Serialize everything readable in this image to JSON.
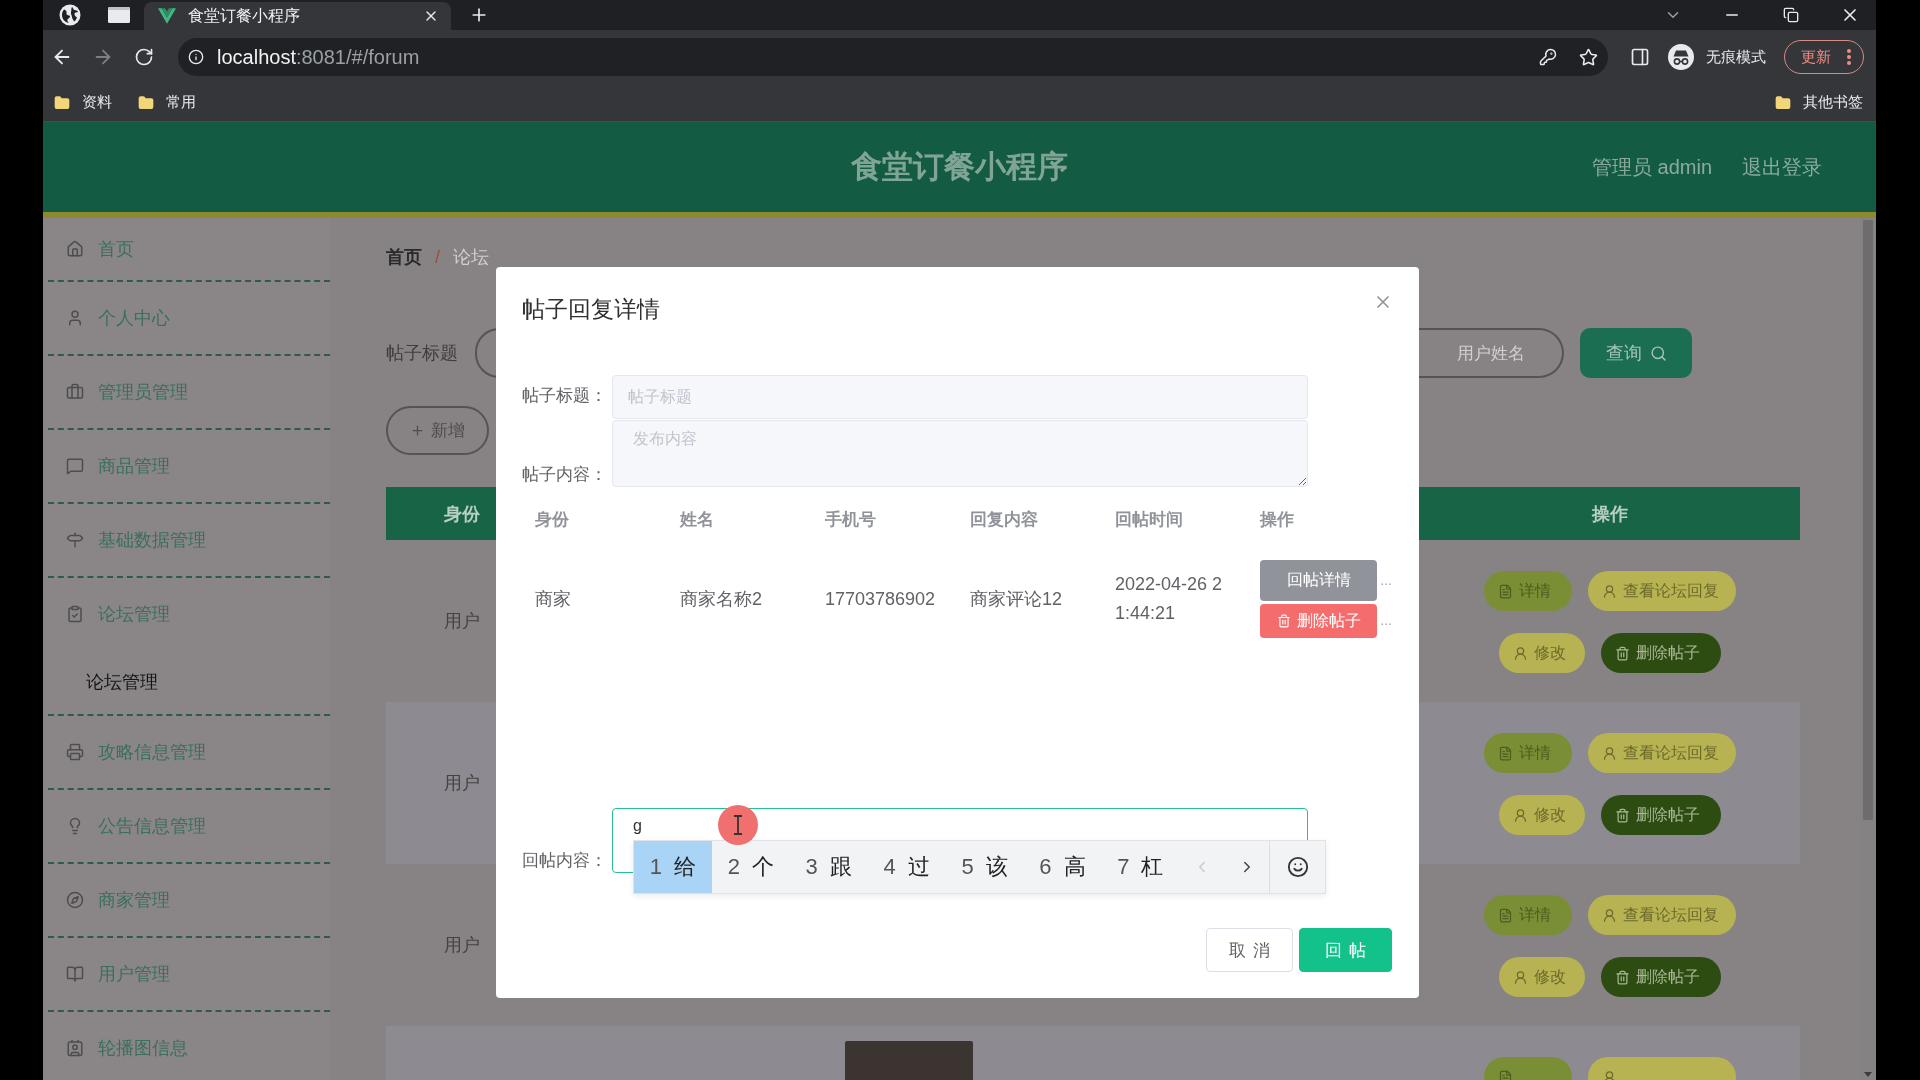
{
  "browser": {
    "tab": {
      "title": "食堂订餐小程序"
    },
    "url": {
      "host": "localhost",
      "rest": ":8081/#/forum"
    },
    "profile": "无痕模式",
    "update_button": "更新",
    "bookmarks": [
      {
        "label": "资料"
      },
      {
        "label": "常用"
      }
    ],
    "other_bookmarks": "其他书签"
  },
  "header": {
    "title": "食堂订餐小程序",
    "user": "管理员 admin",
    "logout": "退出登录"
  },
  "sidebar": {
    "items": [
      {
        "label": "首页"
      },
      {
        "label": "个人中心"
      },
      {
        "label": "管理员管理"
      },
      {
        "label": "商品管理"
      },
      {
        "label": "基础数据管理"
      },
      {
        "label": "论坛管理",
        "children": [
          {
            "label": "论坛管理"
          }
        ]
      },
      {
        "label": "攻略信息管理"
      },
      {
        "label": "公告信息管理"
      },
      {
        "label": "商家管理"
      },
      {
        "label": "用户管理"
      },
      {
        "label": "轮播图信息"
      }
    ]
  },
  "breadcrumb": {
    "separator": "/",
    "items": [
      {
        "label": "首页"
      },
      {
        "label": "论坛"
      }
    ]
  },
  "search": {
    "label": "帖子标题",
    "fields": [
      {
        "placeholder": "用户姓名"
      }
    ],
    "button": "查询"
  },
  "add_button": "新增",
  "table": {
    "columns": [
      {
        "label": "身份"
      },
      {
        "label": "操作"
      }
    ],
    "rows": [
      {
        "identity": "用户",
        "actions": [
          {
            "kind": "detail",
            "label": "详情"
          },
          {
            "kind": "replies",
            "label": "查看论坛回复"
          },
          {
            "kind": "edit",
            "label": "修改"
          },
          {
            "kind": "delete",
            "label": "删除帖子"
          }
        ]
      },
      {
        "identity": "用户",
        "actions": [
          {
            "kind": "detail",
            "label": "详情"
          },
          {
            "kind": "replies",
            "label": "查看论坛回复"
          },
          {
            "kind": "edit",
            "label": "修改"
          },
          {
            "kind": "delete",
            "label": "删除帖子"
          }
        ]
      },
      {
        "identity": "用户",
        "actions": [
          {
            "kind": "detail",
            "label": "详情"
          },
          {
            "kind": "replies",
            "label": "查看论坛回复"
          },
          {
            "kind": "edit",
            "label": "修改"
          },
          {
            "kind": "delete",
            "label": "删除帖子"
          }
        ]
      },
      {
        "photo": true,
        "actions": [
          {
            "kind": "detail"
          },
          {
            "kind": "replies"
          }
        ]
      }
    ]
  },
  "dialog": {
    "title": "帖子回复详情",
    "fields": [
      {
        "kind": "input",
        "label": "帖子标题：",
        "placeholder": "帖子标题",
        "disabled": true
      },
      {
        "kind": "textarea",
        "label": "帖子内容：",
        "placeholder": "发布内容",
        "disabled": true
      }
    ],
    "table": {
      "columns": [
        "身份",
        "姓名",
        "手机号",
        "回复内容",
        "回帖时间",
        "操作"
      ],
      "rows": [
        {
          "cells": [
            "商家",
            "商家名称2",
            "17703786902",
            "商家评论12",
            "2022-04-26 21:44:21"
          ],
          "actions": [
            {
              "kind": "info",
              "label": "回帖详情",
              "trail": "…"
            },
            {
              "kind": "danger",
              "label": "删除帖子",
              "trail": "…"
            }
          ]
        }
      ]
    },
    "reply": {
      "label": "回帖内容：",
      "value": "g",
      "focused": true
    },
    "ime": {
      "candidates": [
        {
          "number": "1",
          "text": "给",
          "selected": true
        },
        {
          "number": "2",
          "text": "个",
          "selected": false
        },
        {
          "number": "3",
          "text": "跟",
          "selected": false
        },
        {
          "number": "4",
          "text": "过",
          "selected": false
        },
        {
          "number": "5",
          "text": "该",
          "selected": false
        },
        {
          "number": "6",
          "text": "高",
          "selected": false
        },
        {
          "number": "7",
          "text": "杠",
          "selected": false
        }
      ],
      "prev_disabled": true,
      "next_disabled": false
    },
    "buttons": [
      {
        "kind": "cancel",
        "label": "取消"
      },
      {
        "kind": "primary",
        "label": "回帖"
      }
    ]
  }
}
